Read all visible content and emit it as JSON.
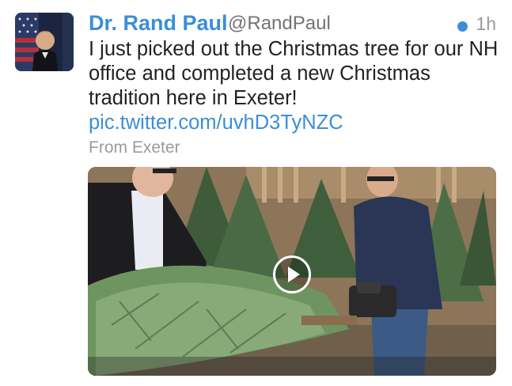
{
  "tweet": {
    "author_name": "Dr. Rand Paul",
    "handle": "@RandPaul",
    "time": "1h",
    "text": "I just picked out the Christmas tree for our NH office and completed a new Christmas tradition here in Exeter! ",
    "link": "pic.twitter.com/uvhD3TyNZC",
    "location": "From Exeter"
  },
  "colors": {
    "accent": "#3b8ed7",
    "muted": "#9a9a9a"
  },
  "icons": {
    "unread": "dot-icon",
    "play": "play-icon"
  }
}
